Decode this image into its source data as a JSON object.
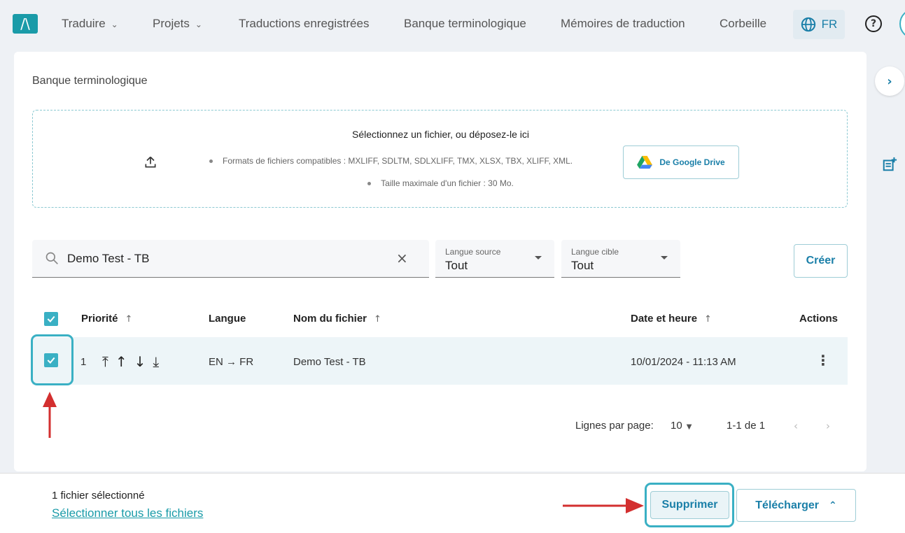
{
  "nav": {
    "logo_glyph": "/\\",
    "items": [
      {
        "label": "Traduire",
        "dropdown": true
      },
      {
        "label": "Projets",
        "dropdown": true
      },
      {
        "label": "Traductions enregistrées",
        "dropdown": false
      },
      {
        "label": "Banque terminologique",
        "dropdown": false
      },
      {
        "label": "Mémoires de traduction",
        "dropdown": false
      },
      {
        "label": "Corbeille",
        "dropdown": false
      }
    ],
    "language": "FR"
  },
  "breadcrumb": "Banque terminologique",
  "dropzone": {
    "title": "Sélectionnez un fichier, ou déposez-le ici",
    "formats": "Formats de fichiers compatibles : MXLIFF, SDLTM, SDLXLIFF, TMX, XLSX, TBX, XLIFF, XML.",
    "max_size": "Taille maximale d'un fichier : 30 Mo.",
    "gdrive_label": "De Google Drive"
  },
  "filters": {
    "search_value": "Demo Test - TB",
    "source_label": "Langue source",
    "source_value": "Tout",
    "target_label": "Langue cible",
    "target_value": "Tout",
    "create_label": "Créer"
  },
  "table": {
    "headers": {
      "priority": "Priorité",
      "language": "Langue",
      "filename": "Nom du fichier",
      "datetime": "Date et heure",
      "actions": "Actions"
    },
    "rows": [
      {
        "priority": "1",
        "language": "EN → FR",
        "filename": "Demo Test - TB",
        "datetime": "10/01/2024 - 11:13 AM",
        "selected": true
      }
    ]
  },
  "pagination": {
    "rows_label": "Lignes par page:",
    "rows_value": "10",
    "range": "1-1 de 1"
  },
  "footer": {
    "selected_count": "1 fichier sélectionné",
    "select_all": "Sélectionner tous les fichiers",
    "delete_label": "Supprimer",
    "download_label": "Télécharger"
  },
  "colors": {
    "accent": "#3ab0c4",
    "link": "#1a7fa8",
    "annotation_arrow": "#d32f2f"
  }
}
